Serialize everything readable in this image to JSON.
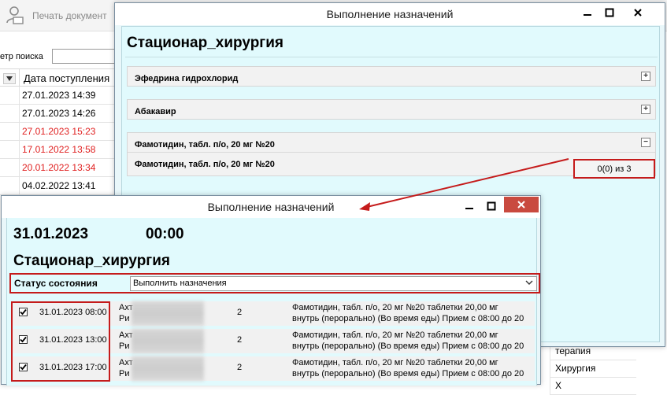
{
  "colors": {
    "accent_red": "#c51b1b",
    "panel_bg": "#e1fafd",
    "overdue_red": "#e02020"
  },
  "background_app": {
    "print_button_label": "Печать документ",
    "filter_label": "етр поиска",
    "grid_header": "Дата поступления",
    "rows": [
      {
        "value": "27.01.2023 14:39",
        "red": false
      },
      {
        "value": "27.01.2023 14:26",
        "red": false
      },
      {
        "value": "27.01.2023 15:23",
        "red": true
      },
      {
        "value": "17.01.2022 13:58",
        "red": true
      },
      {
        "value": "20.01.2022 13:34",
        "red": true
      },
      {
        "value": "04.02.2022 13:41",
        "red": false
      }
    ],
    "bottom_right_cells": [
      "терапия",
      "Хирургия",
      "Х"
    ]
  },
  "window1": {
    "title": "Выполнение назначений",
    "department": "Стационар_хирургия",
    "panels": [
      {
        "label": "Эфедрина гидрохлорид",
        "toggle": "+"
      },
      {
        "label": "Абакавир",
        "toggle": "+"
      },
      {
        "label": "Фамотидин, табл. п/о, 20 мг №20",
        "toggle": "−"
      }
    ],
    "sub_item": {
      "label": "Фамотидин, табл. п/о, 20 мг №20",
      "count": "0(0) из 3"
    }
  },
  "window2": {
    "title": "Выполнение назначений",
    "date": "31.01.2023",
    "time": "00:00",
    "department": "Стационар_хирургия",
    "status_label": "Статус состояния",
    "status_value": "Выполнить назначения",
    "tasks": [
      {
        "checked": true,
        "datetime": "31.01.2023 08:00",
        "patient_line1": "Ахт",
        "patient_line2": "Ри",
        "qty": "2",
        "drug_line1": "Фамотидин, табл. п/о, 20 мг №20 таблетки 20,00 мг",
        "drug_line2": "внутрь (перорально) (Во время еды)   Прием с 08:00 до 20"
      },
      {
        "checked": true,
        "datetime": "31.01.2023 13:00",
        "patient_line1": "Ахт",
        "patient_line2": "Ри",
        "qty": "2",
        "drug_line1": "Фамотидин, табл. п/о, 20 мг №20 таблетки 20,00 мг",
        "drug_line2": "внутрь (перорально) (Во время еды)   Прием с 08:00 до 20"
      },
      {
        "checked": true,
        "datetime": "31.01.2023 17:00",
        "patient_line1": "Ахт",
        "patient_line2": "Ри",
        "qty": "2",
        "drug_line1": "Фамотидин, табл. п/о, 20 мг №20 таблетки 20,00 мг",
        "drug_line2": "внутрь (перорально) (Во время еды)   Прием с 08:00 до 20"
      }
    ]
  }
}
